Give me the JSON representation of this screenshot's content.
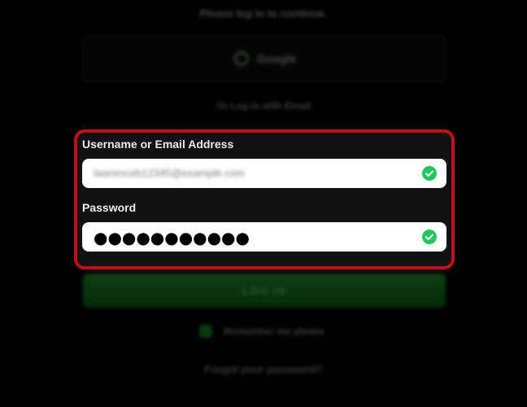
{
  "header": {
    "prompt_text": "Please log in to continue."
  },
  "google_button": {
    "label": "Google",
    "icon": "google-icon"
  },
  "email_login_link": {
    "label": "Or Log in with Email"
  },
  "form": {
    "username": {
      "label": "Username or Email Address",
      "value": "lawrenceb12345@example.com",
      "value_blurred": true,
      "status_icon": "check-circle-icon",
      "status_color": "#22c55e"
    },
    "password": {
      "label": "Password",
      "value": "●●●●●●●●●●●",
      "status_icon": "check-circle-icon",
      "status_color": "#22c55e"
    }
  },
  "login_button": {
    "label": "LOG IN",
    "color": "#0d3f13"
  },
  "remember_me": {
    "label": "Remember me please",
    "checked": true
  },
  "forgot_password": {
    "label": "Forgot your password?"
  },
  "highlight": {
    "color": "#c0101a"
  }
}
